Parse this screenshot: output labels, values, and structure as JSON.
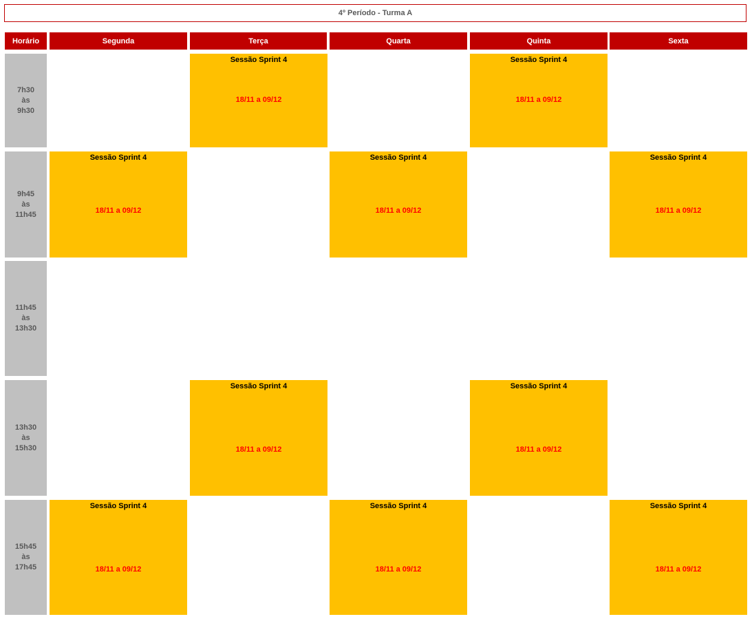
{
  "title": "4º Período - Turma A",
  "headers": {
    "time": "Horário",
    "days": [
      "Segunda",
      "Terça",
      "Quarta",
      "Quinta",
      "Sexta"
    ]
  },
  "slots": [
    {
      "start": "7h30",
      "sep": "às",
      "end": "9h30"
    },
    {
      "start": "9h45",
      "sep": "às",
      "end": "11h45"
    },
    {
      "start": "11h45",
      "sep": "às",
      "end": "13h30"
    },
    {
      "start": "13h30",
      "sep": "às",
      "end": "15h30"
    },
    {
      "start": "15h45",
      "sep": "às",
      "end": "17h45"
    }
  ],
  "session": {
    "title": "Sessão Sprint 4",
    "dates": "18/11 a 09/12"
  },
  "colors": {
    "header_bg": "#c00000",
    "session_bg": "#ffc000",
    "date_text": "#ff0000",
    "time_bg": "#c0c0c0"
  }
}
